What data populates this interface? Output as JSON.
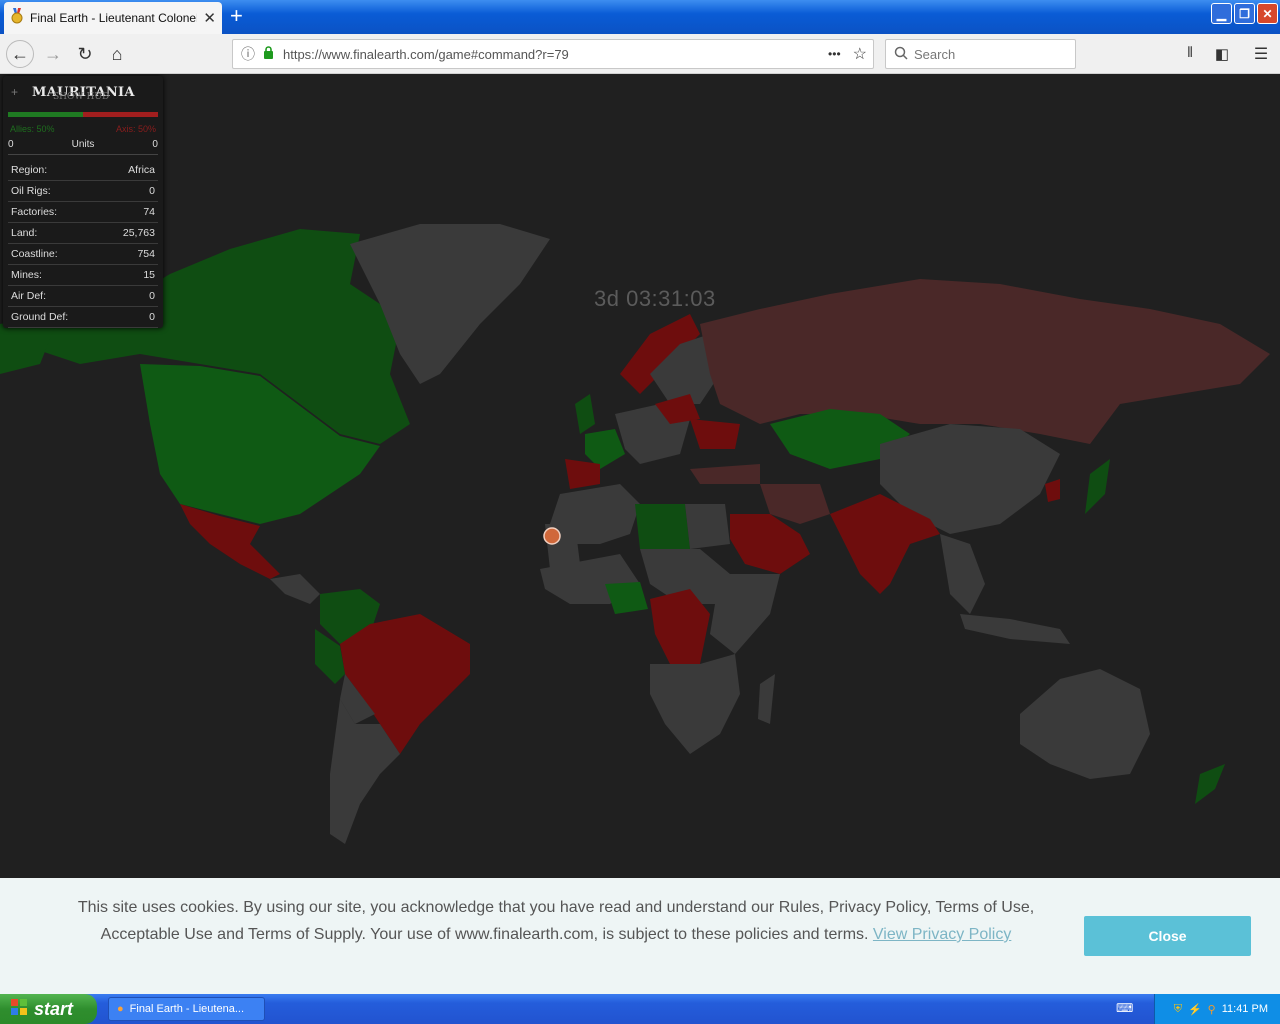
{
  "browser": {
    "tab_title": "Final Earth - Lieutenant Colonel Vi",
    "url": "https://www.finalearth.com/game#command?r=79",
    "search_placeholder": "Search",
    "new_tab": "+",
    "tab_close": "✕",
    "url_more": "•••"
  },
  "game": {
    "timer": "3d 03:31:03",
    "hud": {
      "country": "MAURITANIA",
      "show_hud": "SHOW HUD",
      "allies_label": "Allies: 50%",
      "axis_label": "Axis: 50%",
      "allies_fraction": 0.5,
      "units_left": "0",
      "units_label": "Units",
      "units_right": "0",
      "rows": [
        {
          "label": "Region:",
          "value": "Africa"
        },
        {
          "label": "Oil Rigs:",
          "value": "0"
        },
        {
          "label": "Factories:",
          "value": "74"
        },
        {
          "label": "Land:",
          "value": "25,763"
        },
        {
          "label": "Coastline:",
          "value": "754"
        },
        {
          "label": "Mines:",
          "value": "15"
        },
        {
          "label": "Air Def:",
          "value": "0"
        },
        {
          "label": "Ground Def:",
          "value": "0"
        }
      ]
    },
    "colors": {
      "allies": "#0f5a14",
      "axis": "#6e0d0d",
      "neutral": "#3a3a3a",
      "ocean": "#202020"
    }
  },
  "cookie": {
    "text": "This site uses cookies. By using our site, you acknowledge that you have read and understand our Rules, Privacy Policy, Terms of Use, Acceptable Use and Terms of Supply. Your use of www.finalearth.com, is subject to these policies and terms.",
    "link": "View Privacy Policy",
    "close": "Close"
  },
  "taskbar": {
    "start": "start",
    "task": "Final Earth - Lieutena...",
    "clock": "11:41 PM"
  }
}
